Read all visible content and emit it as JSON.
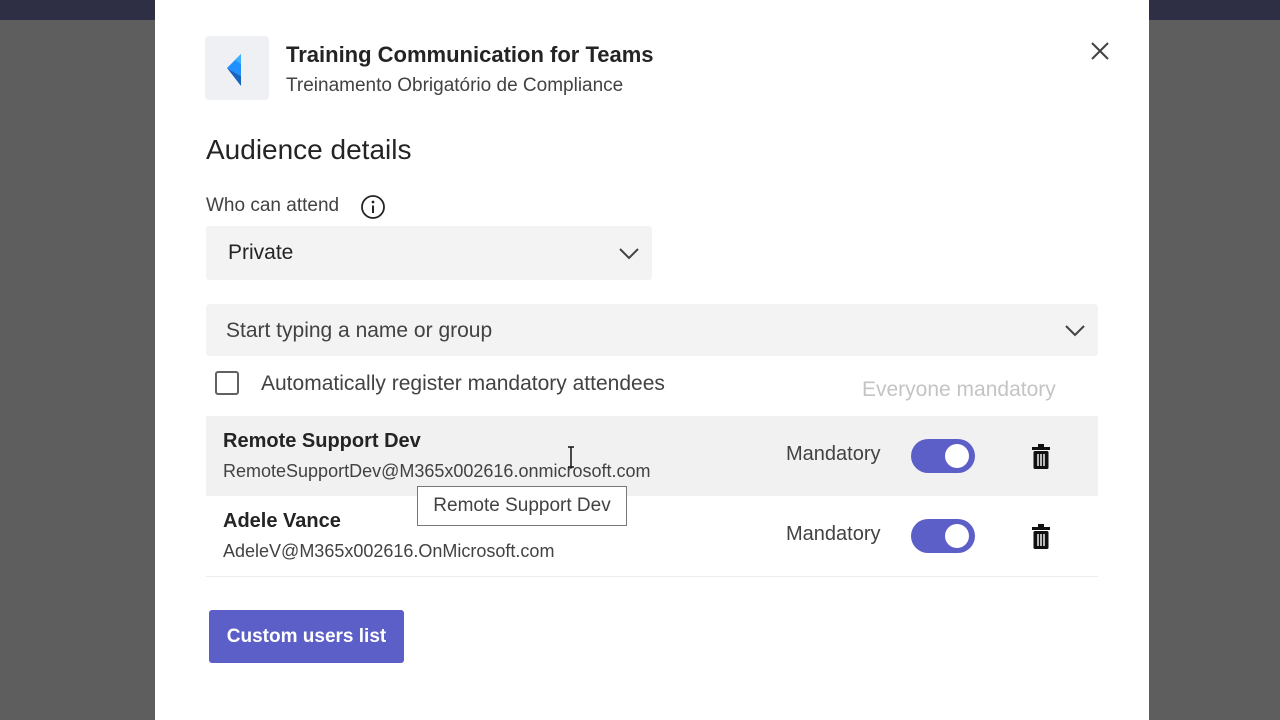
{
  "colors": {
    "brand": "#5b5fc7",
    "dialog_bg": "#ffffff",
    "field_bg": "#f3f3f3",
    "backdrop": "#5e5e5e"
  },
  "header": {
    "app_icon": "training-app-logo-icon",
    "title": "Training Communication for Teams",
    "subtitle": "Treinamento Obrigatório de Compliance",
    "close_icon": "close-icon"
  },
  "audience": {
    "section_title": "Audience details",
    "who_label": "Who can attend",
    "info_icon": "info-icon",
    "who_value": "Private",
    "picker_placeholder": "Start typing a name or group",
    "auto_register_label": "Automatically register mandatory attendees",
    "auto_register_checked": false,
    "everyone_mandatory": "Everyone mandatory"
  },
  "attendees": [
    {
      "name": "Remote Support Dev",
      "email": "RemoteSupportDev@M365x002616.onmicrosoft.com",
      "mandatory_label": "Mandatory",
      "mandatory": true
    },
    {
      "name": "Adele Vance",
      "email": "AdeleV@M365x002616.OnMicrosoft.com",
      "mandatory_label": "Mandatory",
      "mandatory": true
    }
  ],
  "tooltip": "Remote Support Dev",
  "custom_users_button": "Custom users list"
}
